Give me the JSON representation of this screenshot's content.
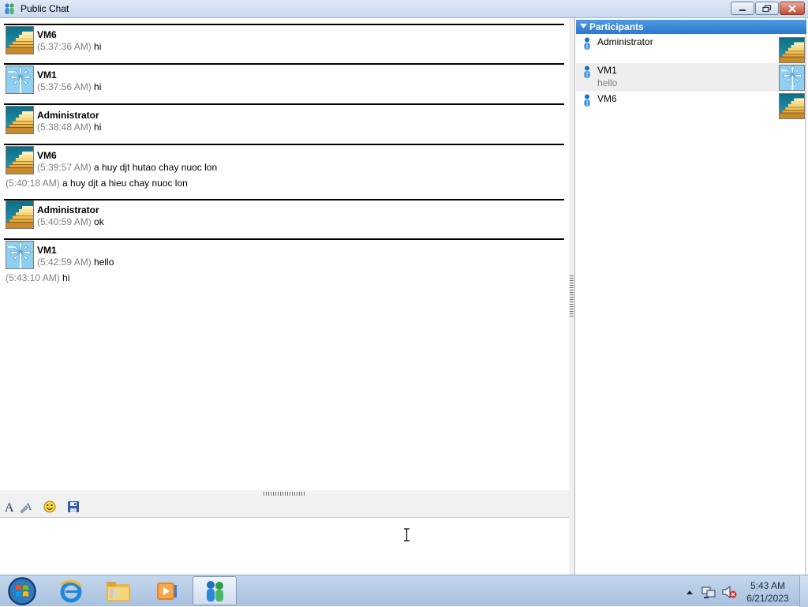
{
  "window": {
    "title": "Public Chat"
  },
  "messages": [
    {
      "sender": "VM6",
      "avatar": "stairs",
      "lines": [
        {
          "time": "(5:37:36 AM)",
          "text": "hi"
        }
      ]
    },
    {
      "sender": "VM1",
      "avatar": "pinwheel",
      "lines": [
        {
          "time": "(5:37:56 AM)",
          "text": "hi"
        }
      ]
    },
    {
      "sender": "Administrator",
      "avatar": "stairs",
      "lines": [
        {
          "time": "(5:38:48 AM)",
          "text": "hi"
        }
      ]
    },
    {
      "sender": "VM6",
      "avatar": "stairs",
      "lines": [
        {
          "time": "(5:39:57 AM)",
          "text": "a huy djt hutao chay nuoc lon"
        },
        {
          "time": "(5:40:18 AM)",
          "text": "a huy djt a hieu chay nuoc lon"
        }
      ]
    },
    {
      "sender": "Administrator",
      "avatar": "stairs",
      "lines": [
        {
          "time": "(5:40:59 AM)",
          "text": "ok"
        }
      ]
    },
    {
      "sender": "VM1",
      "avatar": "pinwheel",
      "lines": [
        {
          "time": "(5:42:59 AM)",
          "text": "hello"
        },
        {
          "time": "(5:43:10 AM)",
          "text": "hi"
        }
      ]
    }
  ],
  "toolbar": {
    "icons": [
      "font-icon",
      "font-color-icon",
      "emoticon-icon",
      "save-icon"
    ]
  },
  "participants": {
    "header": "Participants",
    "list": [
      {
        "name": "Administrator",
        "status": "",
        "avatar": "stairs"
      },
      {
        "name": "VM1",
        "status": "hello",
        "avatar": "pinwheel",
        "highlighted": true
      },
      {
        "name": "VM6",
        "status": "",
        "avatar": "stairs"
      }
    ]
  },
  "taskbar": {
    "apps": [
      "start-button",
      "internet-explorer",
      "windows-explorer",
      "media-player",
      "messenger"
    ],
    "active_app": "messenger",
    "clock_time": "5:43 AM",
    "clock_date": "6/21/2023"
  },
  "colors": {
    "participants_header": "#3a86d8",
    "timestamp": "#808080",
    "separator": "#000000"
  }
}
